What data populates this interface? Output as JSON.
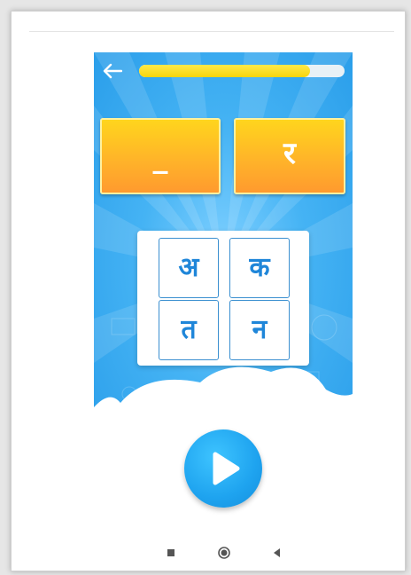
{
  "game": {
    "progress_fraction": 0.83,
    "answer_slots": [
      {
        "text": "_"
      },
      {
        "text": "र"
      }
    ],
    "letter_tiles": [
      "अ",
      "क",
      "त",
      "न"
    ]
  },
  "icons": {
    "back": "arrow-left-icon",
    "play": "play-icon",
    "nav_recents": "square-icon",
    "nav_home": "circle-icon",
    "nav_back": "triangle-back-icon"
  },
  "colors": {
    "sky_blue": "#45b3f4",
    "answer_orange": "#ffb12a",
    "progress_yellow": "#f7d50c",
    "tile_blue": "#1f86d9",
    "play_blue": "#1ea3ef"
  }
}
